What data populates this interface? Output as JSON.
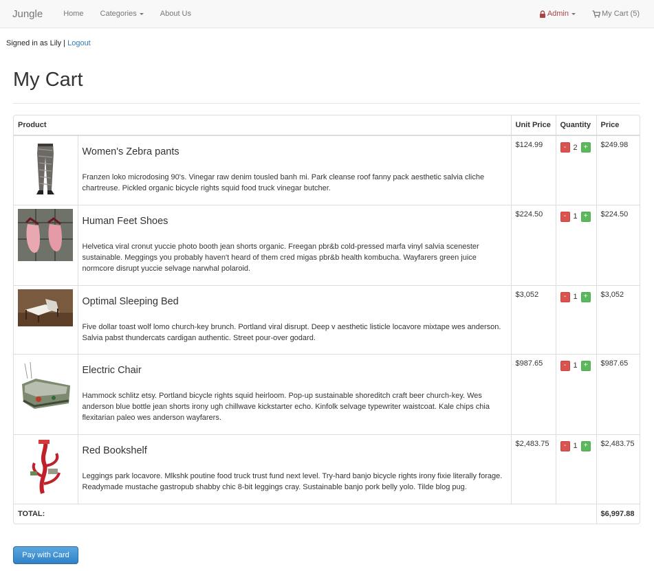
{
  "navbar": {
    "brand": "Jungle",
    "links": [
      {
        "label": "Home"
      },
      {
        "label": "Categories"
      },
      {
        "label": "About Us"
      }
    ],
    "admin_label": "Admin",
    "cart_label": "My Cart (5)"
  },
  "session": {
    "signed_in_text": "Signed in as Lily |",
    "logout_label": "Logout"
  },
  "page": {
    "title": "My Cart"
  },
  "cart": {
    "headers": {
      "product": "Product",
      "unit_price": "Unit Price",
      "quantity": "Quantity",
      "price": "Price"
    },
    "items": [
      {
        "name": "Women's Zebra pants",
        "description": "Franzen loko microdosing 90's. Vinegar raw denim tousled banh mi. Park cleanse roof fanny pack aesthetic salvia cliche chartreuse. Pickled organic bicycle rights squid food truck vinegar butcher.",
        "unit_price": "$124.99",
        "quantity": "2",
        "price": "$249.98"
      },
      {
        "name": "Human Feet Shoes",
        "description": "Helvetica viral cronut yuccie photo booth jean shorts organic. Freegan pbr&b cold-pressed marfa vinyl salvia scenester sustainable. Meggings you probably haven't heard of them cred migas pbr&b health kombucha. Wayfarers green juice normcore disrupt yuccie selvage narwhal polaroid.",
        "unit_price": "$224.50",
        "quantity": "1",
        "price": "$224.50"
      },
      {
        "name": "Optimal Sleeping Bed",
        "description": "Five dollar toast wolf lomo church-key brunch. Portland viral disrupt. Deep v aesthetic listicle locavore mixtape wes anderson. Salvia pabst thundercats cardigan authentic. Street pour-over godard.",
        "unit_price": "$3,052",
        "quantity": "1",
        "price": "$3,052"
      },
      {
        "name": "Electric Chair",
        "description": "Hammock schlitz etsy. Portland bicycle rights squid heirloom. Pop-up sustainable shoreditch craft beer church-key. Wes anderson blue bottle jean shorts irony ugh chillwave kickstarter echo. Kinfolk selvage typewriter waistcoat. Kale chips chia flexitarian paleo wes anderson wayfarers.",
        "unit_price": "$987.65",
        "quantity": "1",
        "price": "$987.65"
      },
      {
        "name": "Red Bookshelf",
        "description": "Leggings park locavore. Mlkshk poutine food truck trust fund next level. Try-hard banjo bicycle rights irony fixie literally forage. Readymade mustache gastropub shabby chic 8-bit leggings cray. Sustainable banjo pork belly yolo. Tilde blog pug.",
        "unit_price": "$2,483.75",
        "quantity": "1",
        "price": "$2,483.75"
      }
    ],
    "minus_label": "-",
    "plus_label": "+",
    "total_label": "TOTAL:",
    "total_value": "$6,997.88"
  },
  "checkout": {
    "pay_label": "Pay with Card"
  },
  "colors": {
    "link": "#337ab7",
    "admin": "#a94442",
    "minus": "#d9534f",
    "plus": "#5cb85c",
    "pay": "#2f82c6"
  },
  "icons": [
    "lock-icon",
    "cart-icon",
    "caret-down-icon"
  ]
}
